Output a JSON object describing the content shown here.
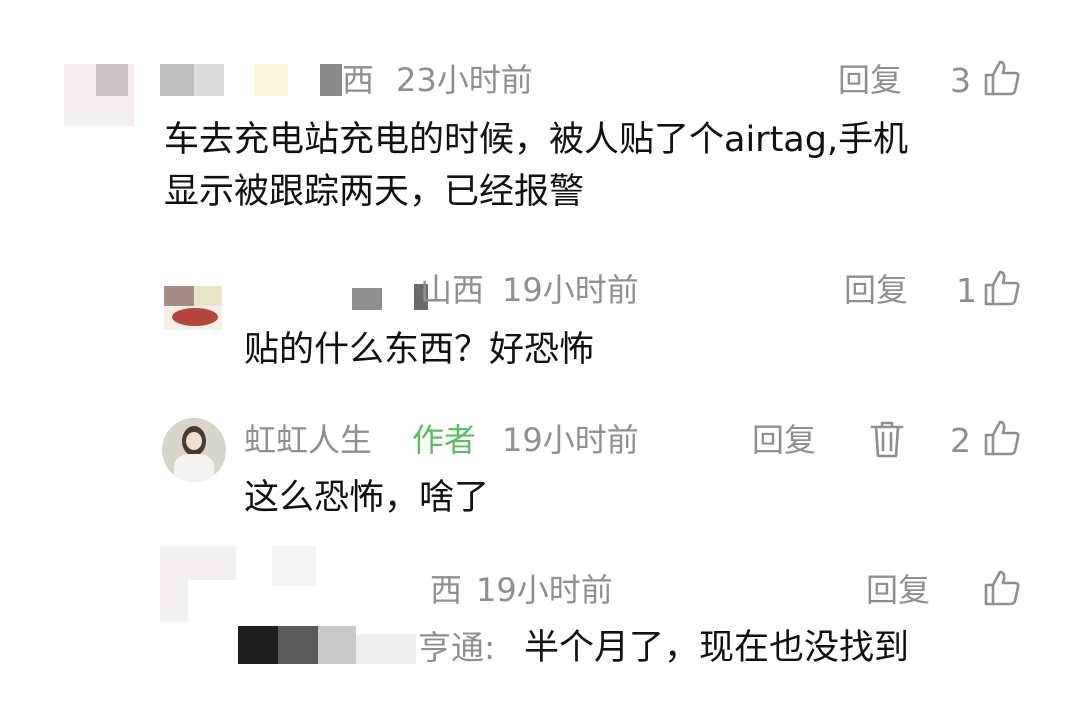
{
  "comments": [
    {
      "location": "西",
      "time": "23小时前",
      "reply_label": "回复",
      "like_count": "3",
      "text": "车去充电站充电的时候，被人贴了个airtag,手机显示被跟踪两天，已经报警",
      "text_line1": "车去充电站充电的时候，被人贴了个airtag,手机",
      "text_line2": "显示被跟踪两天，已经报警"
    },
    {
      "location": "山西",
      "time": "19小时前",
      "reply_label": "回复",
      "like_count": "1",
      "text": "贴的什么东西？好恐怖"
    },
    {
      "username": "虹虹人生",
      "author_badge": "作者",
      "time": "19小时前",
      "reply_label": "回复",
      "like_count": "2",
      "text": "这么恐怖，啥了"
    },
    {
      "location": "西",
      "time": "19小时前",
      "reply_label": "回复",
      "reply_to_partial": "亨通:",
      "text": "半个月了，现在也没找到"
    }
  ],
  "icons": {
    "like": "thumbs-up-icon",
    "delete": "trash-icon"
  },
  "colors": {
    "author_badge": "#5cbc63",
    "meta_gray": "#8f8f8f",
    "text": "#111111"
  }
}
